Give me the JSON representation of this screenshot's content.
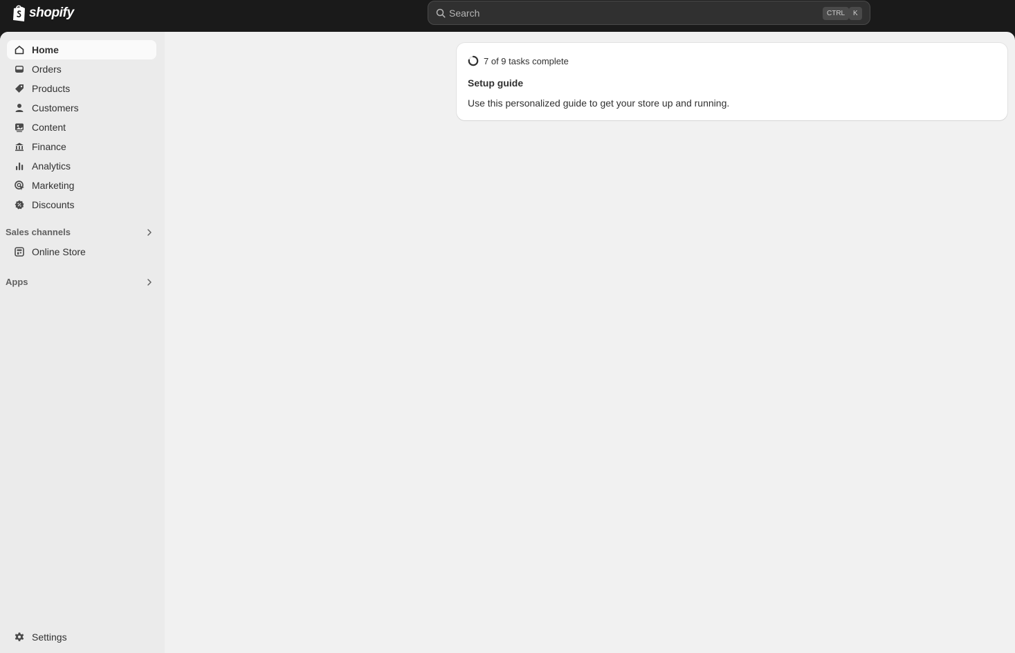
{
  "brand": {
    "name": "shopify"
  },
  "search": {
    "placeholder": "Search",
    "shortcut_ctrl": "CTRL",
    "shortcut_key": "K"
  },
  "sidebar": {
    "items": [
      {
        "label": "Home",
        "icon": "home-icon",
        "active": true
      },
      {
        "label": "Orders",
        "icon": "inbox-icon"
      },
      {
        "label": "Products",
        "icon": "tag-icon"
      },
      {
        "label": "Customers",
        "icon": "person-icon"
      },
      {
        "label": "Content",
        "icon": "image-icon"
      },
      {
        "label": "Finance",
        "icon": "bank-icon"
      },
      {
        "label": "Analytics",
        "icon": "bar-chart-icon"
      },
      {
        "label": "Marketing",
        "icon": "target-icon"
      },
      {
        "label": "Discounts",
        "icon": "discount-icon"
      }
    ],
    "sales_channels": {
      "label": "Sales channels",
      "items": [
        {
          "label": "Online Store",
          "icon": "store-icon"
        }
      ]
    },
    "apps": {
      "label": "Apps"
    },
    "settings": {
      "label": "Settings",
      "icon": "gear-icon"
    }
  },
  "setup_guide": {
    "progress_text": "7 of 9 tasks complete",
    "completed": 7,
    "total": 9,
    "title": "Setup guide",
    "description": "Use this personalized guide to get your store up and running."
  },
  "colors": {
    "topbar": "#1a1a1a",
    "sidebar": "#ebebeb",
    "main": "#f1f1f1",
    "card": "#ffffff"
  }
}
